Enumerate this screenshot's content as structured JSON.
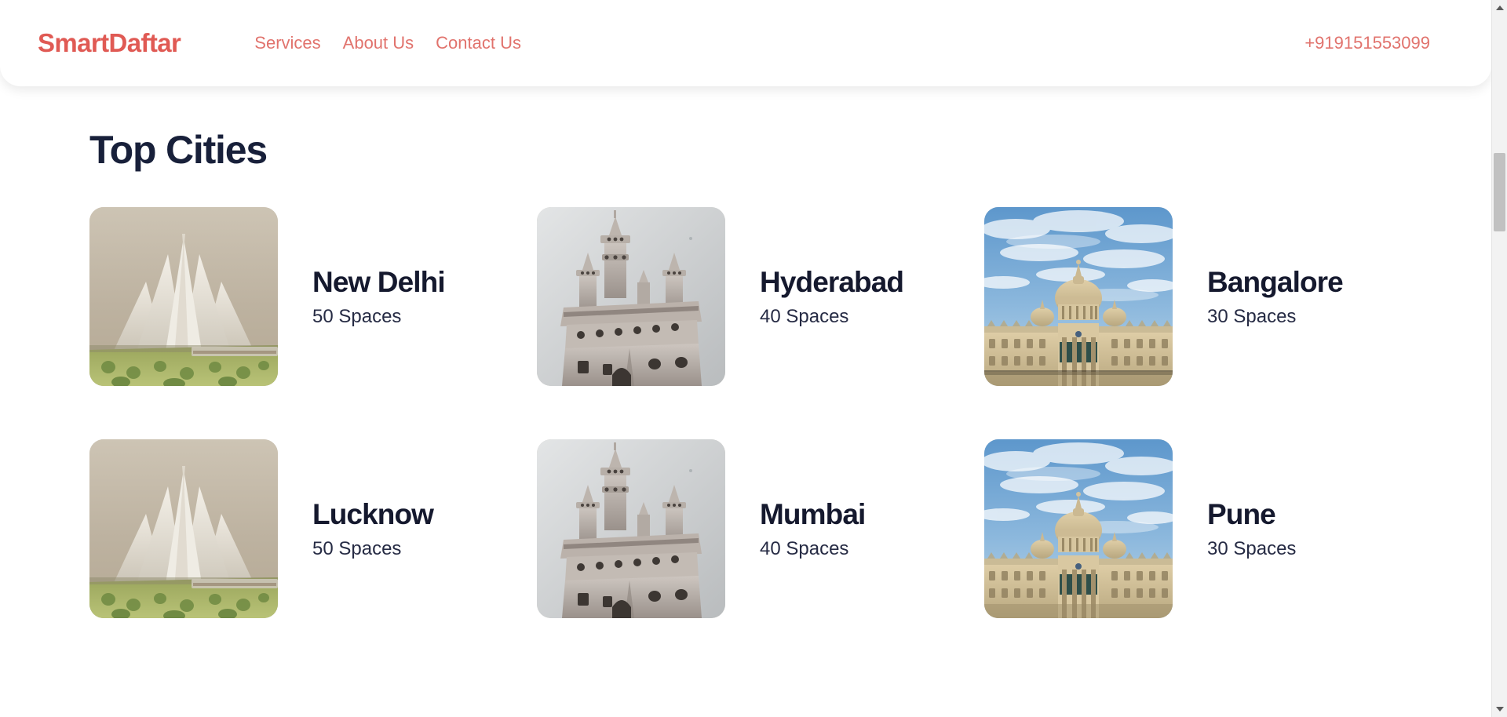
{
  "header": {
    "logo": "SmartDaftar",
    "nav": [
      {
        "label": "Services"
      },
      {
        "label": "About Us"
      },
      {
        "label": "Contact Us"
      }
    ],
    "phone": "+919151553099",
    "accent_color": "#e05a54",
    "nav_link_color": "#e1736d"
  },
  "main": {
    "section_title": "Top Cities",
    "title_color": "#18203a",
    "cities": [
      {
        "name": "New Delhi",
        "spaces": "50 Spaces",
        "landmark": "lotus-temple"
      },
      {
        "name": "Hyderabad",
        "spaces": "40 Spaces",
        "landmark": "charminar"
      },
      {
        "name": "Bangalore",
        "spaces": "30 Spaces",
        "landmark": "vidhana-soudha"
      },
      {
        "name": "Lucknow",
        "spaces": "50 Spaces",
        "landmark": "lotus-temple"
      },
      {
        "name": "Mumbai",
        "spaces": "40 Spaces",
        "landmark": "charminar"
      },
      {
        "name": "Pune",
        "spaces": "30 Spaces",
        "landmark": "vidhana-soudha"
      }
    ]
  },
  "scrollbar": {
    "up_arrow": "scroll-up",
    "down_arrow": "scroll-down"
  }
}
